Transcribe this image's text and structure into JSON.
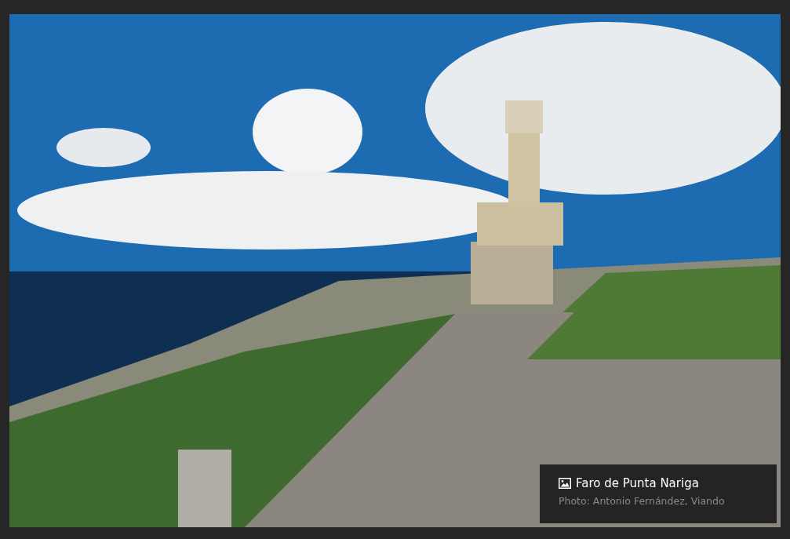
{
  "caption": {
    "title": "Faro de Punta Nariga",
    "credit": "Photo: Antonio Fernández, Viando"
  }
}
